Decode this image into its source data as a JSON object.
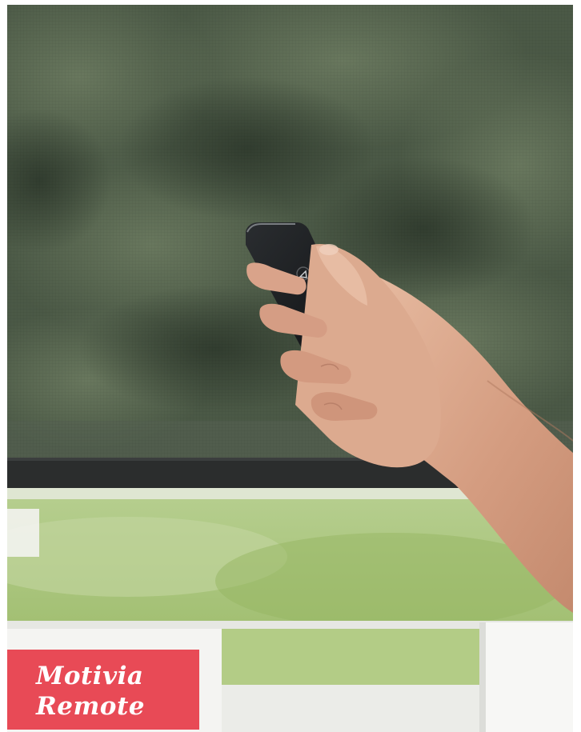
{
  "photo": {
    "subject": "hand-holding-remote-control",
    "colors": {
      "foliage": "#4f5e4a",
      "screen_fabric": "#3a4238",
      "rail": "#2a2c2c",
      "lawn": "#a9c47c",
      "remote_body": "#141618",
      "skin": "#d9a88e"
    }
  },
  "label": {
    "line1": "Motivia",
    "line2": "Remote",
    "background_color": "#e84a56",
    "text_color": "#ffffff"
  }
}
